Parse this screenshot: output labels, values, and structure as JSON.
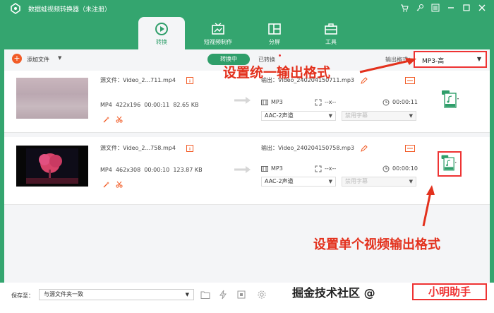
{
  "app": {
    "title": "数据蛙视频转换器（未注册）"
  },
  "titlebar_icons": [
    "cart-icon",
    "key-icon",
    "menu-icon",
    "minimize-icon",
    "maximize-icon",
    "close-icon"
  ],
  "modes": [
    {
      "label": "转换",
      "icon": "convert-icon"
    },
    {
      "label": "短视频制作",
      "icon": "short-video-icon"
    },
    {
      "label": "分屏",
      "icon": "split-screen-icon"
    },
    {
      "label": "工具",
      "icon": "toolbox-icon"
    }
  ],
  "toolbar": {
    "add_label": "添加文件",
    "tab_converting": "转换中",
    "tab_done": "已转换",
    "format_label": "输出格式：",
    "format_value": "MP3-高"
  },
  "rows": [
    {
      "source": "源文件：Video_2...711.mp4",
      "format": "MP4",
      "resolution": "422x196",
      "duration": "00:00:11",
      "size": "82.65 KB",
      "output": "输出：Video_240204150711.mp3",
      "out_format": "MP3",
      "out_res": "--x--",
      "out_duration": "00:00:11",
      "audio": "AAC-2声道",
      "subtitle": "禁用字幕"
    },
    {
      "source": "源文件：Video_2...758.mp4",
      "format": "MP4",
      "resolution": "462x308",
      "duration": "00:00:10",
      "size": "123.87 KB",
      "output": "输出：Video_240204150758.mp3",
      "out_format": "MP3",
      "out_res": "--x--",
      "out_duration": "00:00:10",
      "audio": "AAC-2声道",
      "subtitle": "禁用字幕"
    }
  ],
  "annotations": {
    "top": "设置统一输出格式",
    "bottom": "设置单个视频输出格式"
  },
  "bottombar": {
    "save_label": "保存至：",
    "save_path": "与源文件夹一致"
  },
  "watermark": {
    "text": "掘金技术社区",
    "at": "@",
    "author": "小明助手"
  }
}
